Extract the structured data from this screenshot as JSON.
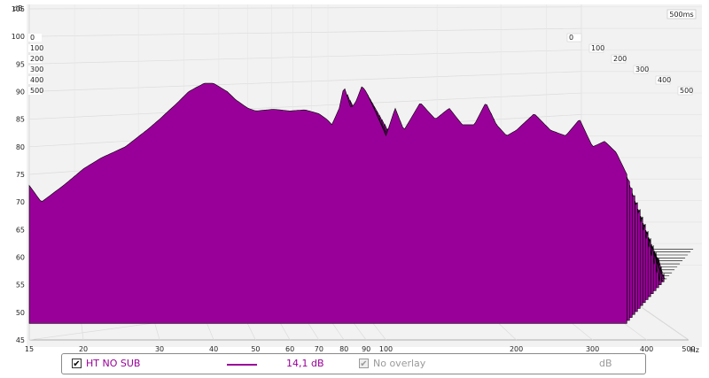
{
  "chart_data": {
    "type": "waterfall",
    "xlabel": "Hz",
    "ylabel": "dB",
    "x_scale": "log",
    "xlim": [
      15,
      500
    ],
    "ylim": [
      45,
      105
    ],
    "x_ticks": [
      "15",
      "20",
      "30",
      "40",
      "50",
      "60",
      "70",
      "80",
      "90",
      "100",
      "200",
      "300",
      "400",
      "500"
    ],
    "x_tick_values": [
      15,
      20,
      30,
      40,
      50,
      60,
      70,
      80,
      90,
      100,
      200,
      300,
      400,
      500
    ],
    "y_ticks": [
      "45",
      "50",
      "55",
      "60",
      "65",
      "70",
      "75",
      "80",
      "85",
      "90",
      "95",
      "100",
      "105"
    ],
    "y_tick_values": [
      45,
      50,
      55,
      60,
      65,
      70,
      75,
      80,
      85,
      90,
      95,
      100,
      105
    ],
    "time_axis_label": "500ms",
    "time_ticks": [
      "0",
      "100",
      "200",
      "300",
      "400",
      "500"
    ],
    "series": [
      {
        "name": "HT NO SUB",
        "color": "#990099",
        "front_slice_ms": 0,
        "x": [
          15,
          16,
          18,
          20,
          22,
          25,
          28,
          30,
          33,
          35,
          38,
          40,
          43,
          45,
          48,
          50,
          55,
          60,
          65,
          70,
          73,
          75,
          78,
          80,
          83,
          85,
          88,
          90,
          95,
          100,
          105,
          110,
          120,
          130,
          140,
          150,
          160,
          170,
          180,
          190,
          200,
          220,
          240,
          260,
          280,
          300,
          320,
          340,
          360
        ],
        "values": [
          73,
          70,
          73,
          76,
          78,
          80,
          83,
          85,
          88,
          90,
          91.5,
          91.5,
          90,
          88.5,
          87,
          86.5,
          86.8,
          86.5,
          86.7,
          86,
          85,
          84,
          87,
          91,
          87,
          88,
          91,
          90,
          86,
          82,
          87,
          83,
          88,
          85,
          87,
          84,
          84,
          88,
          84,
          82,
          83,
          86,
          83,
          82,
          85,
          80,
          81,
          79,
          75
        ]
      }
    ]
  },
  "legend": {
    "series_name": "HT NO SUB",
    "series_checked": "✔",
    "level": "14,1 dB",
    "overlay_label": "No overlay",
    "overlay_checked": "✔",
    "overlay_unit": "dB"
  },
  "colors": {
    "fill": "#990099",
    "outline": "#000000",
    "grid": "#d9d9d9",
    "legend_text": "#990099",
    "disabled_text": "#9a9a9a"
  }
}
